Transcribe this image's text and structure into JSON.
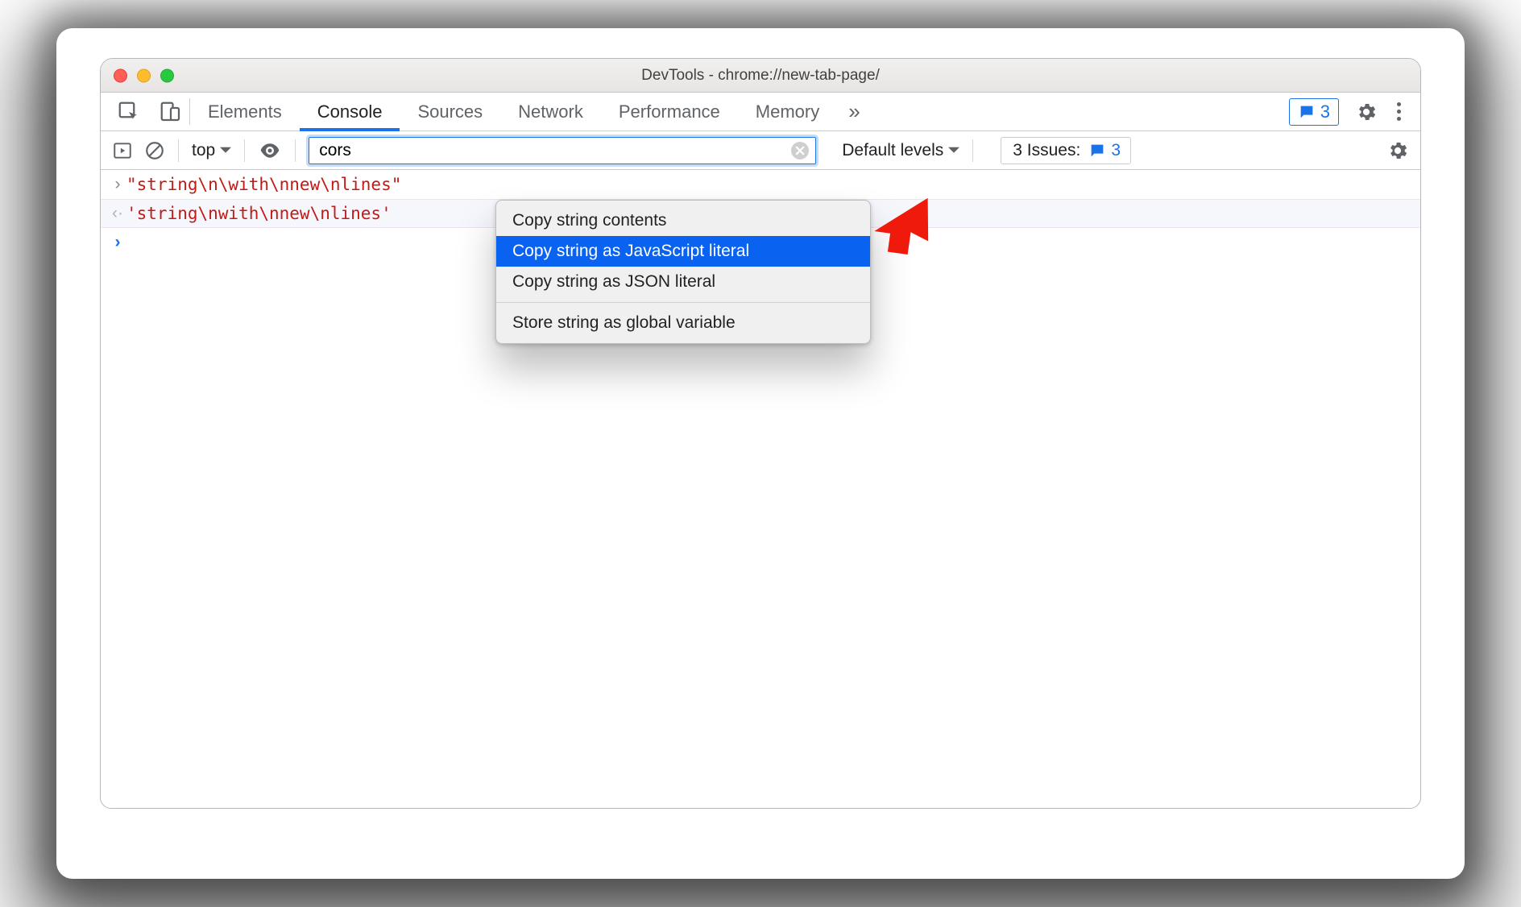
{
  "window": {
    "title": "DevTools - chrome://new-tab-page/"
  },
  "tabs": {
    "items": [
      "Elements",
      "Console",
      "Sources",
      "Network",
      "Performance",
      "Memory"
    ],
    "activeIndex": 1,
    "moreGlyph": "»",
    "badgeCount": "3"
  },
  "toolbar": {
    "context": "top",
    "filterValue": "cors",
    "levels": "Default levels",
    "issuesLabel": "3 Issues:",
    "issuesCount": "3"
  },
  "console": {
    "line1": "\"string\\n\\with\\nnew\\nlines\"",
    "line2": "'string\\nwith\\nnew\\nlines'"
  },
  "menu": {
    "item1": "Copy string contents",
    "item2": "Copy string as JavaScript literal",
    "item3": "Copy string as JSON literal",
    "item4": "Store string as global variable"
  }
}
